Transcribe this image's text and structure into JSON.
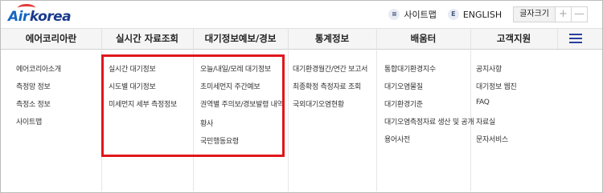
{
  "logo": {
    "part1": "Air",
    "part2": "korea"
  },
  "toplinks": {
    "sitemap_icon": "≡",
    "sitemap": "사이트맵",
    "english_icon": "E",
    "english": "ENGLISH",
    "fontsize_label": "글자크기",
    "plus": "+",
    "minus": "—"
  },
  "nav": {
    "items": [
      "에어코리아란",
      "실시간 자료조회",
      "대기정보예보/경보",
      "통계정보",
      "배움터",
      "고객지원"
    ]
  },
  "menu": {
    "col1": [
      "에어코리아소개",
      "측정망 정보",
      "측정소 정보",
      "사이트맵"
    ],
    "col2": [
      "실시간 대기정보",
      "시도별 대기정보",
      "미세먼지 세부 측정정보"
    ],
    "col3": [
      "오늘/내일/모레 대기정보",
      "초미세먼지 주간예보",
      "권역별 주의보/경보발령 내역",
      "황사",
      "국민행동요령"
    ],
    "col4": [
      "대기환경월간/연간 보고서",
      "최종확정 측정자료 조회",
      "국외대기오염현황"
    ],
    "col5": [
      "통합대기환경지수",
      "대기오염물질",
      "대기환경기준",
      "대기오염측정자료 생산 및 공개",
      "용어사전"
    ],
    "col6": [
      "공지사항",
      "대기정보 웹진",
      "FAQ",
      "자료실",
      "문자서비스"
    ]
  },
  "colors": {
    "highlight": "#e0161b",
    "brand_blue": "#1565c0",
    "nav_bg": "#f5f5f5"
  }
}
